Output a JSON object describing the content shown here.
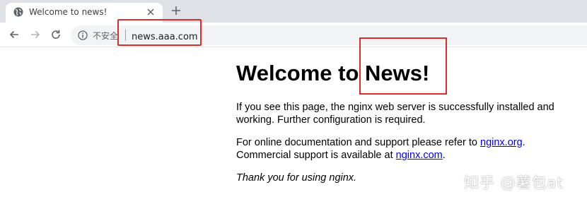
{
  "browser": {
    "tab": {
      "title": "Welcome to news!",
      "favicon": "globe-icon"
    },
    "toolbar": {
      "security_label": "不安全",
      "url": "news.aaa.com"
    }
  },
  "page": {
    "heading": "Welcome to News!",
    "paragraph1": "If you see this page, the nginx web server is successfully installed and working. Further configuration is required.",
    "paragraph2_before": "For online documentation and support please refer to ",
    "paragraph2_link1": "nginx.org",
    "paragraph2_middle": ".\nCommercial support is available at ",
    "paragraph2_link2": "nginx.com",
    "paragraph2_after": ".",
    "paragraph3": "Thank you for using nginx."
  },
  "watermark": "知乎 @薯包at",
  "colors": {
    "highlight": "#e02b2b",
    "link": "#0000ee",
    "tabbar": "#dee1e6",
    "omnibox": "#f1f3f4"
  }
}
